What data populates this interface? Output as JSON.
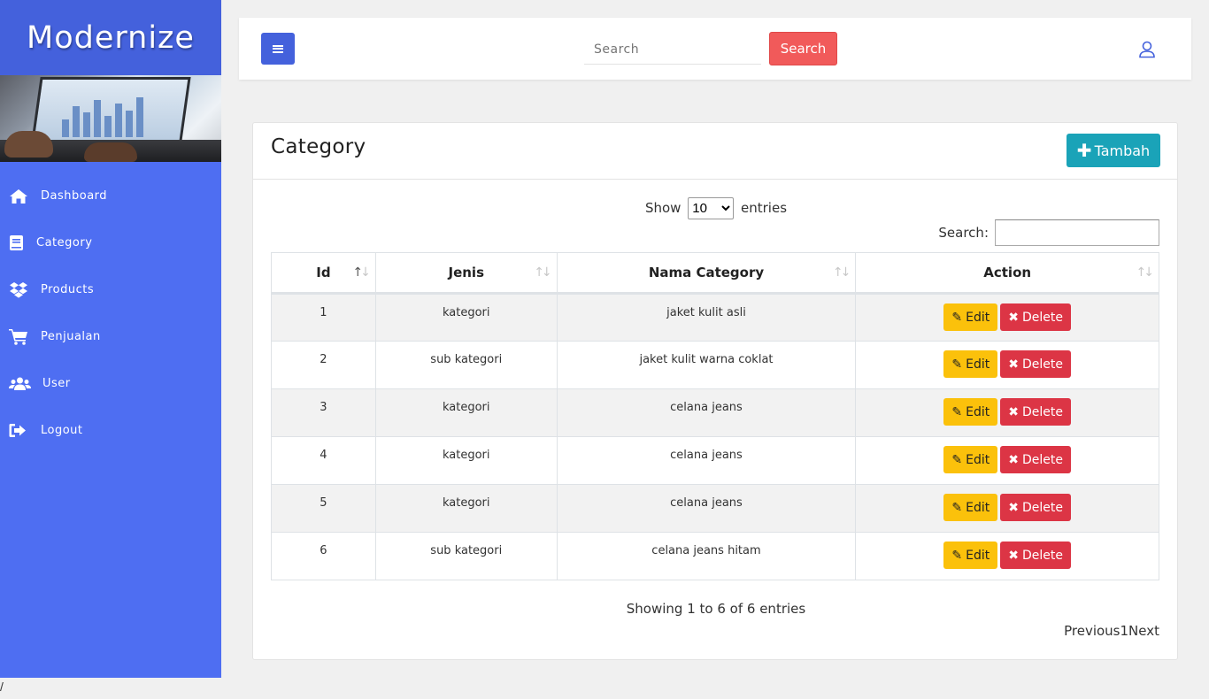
{
  "app": {
    "brand": "Modernize"
  },
  "sidebar": {
    "items": [
      {
        "label": "Dashboard",
        "icon": "home-icon"
      },
      {
        "label": "Category",
        "icon": "book-icon"
      },
      {
        "label": "Products",
        "icon": "dropbox-icon"
      },
      {
        "label": "Penjualan",
        "icon": "cart-icon"
      },
      {
        "label": "User",
        "icon": "users-icon"
      },
      {
        "label": "Logout",
        "icon": "sign-out-icon"
      }
    ]
  },
  "topbar": {
    "search_placeholder": "Search",
    "search_button": "Search"
  },
  "card": {
    "title": "Category",
    "add_button": "Tambah"
  },
  "datatable": {
    "show_label": "Show",
    "page_length": "10",
    "entries_label": "entries",
    "search_label": "Search:",
    "columns": [
      "Id",
      "Jenis",
      "Nama Category",
      "Action"
    ],
    "rows": [
      {
        "id": "1",
        "jenis": "kategori",
        "nama": "jaket kulit asli"
      },
      {
        "id": "2",
        "jenis": "sub kategori",
        "nama": "jaket kulit warna coklat"
      },
      {
        "id": "3",
        "jenis": "kategori",
        "nama": "celana jeans"
      },
      {
        "id": "4",
        "jenis": "kategori",
        "nama": "celana jeans"
      },
      {
        "id": "5",
        "jenis": "kategori",
        "nama": "celana jeans"
      },
      {
        "id": "6",
        "jenis": "sub kategori",
        "nama": "celana jeans hitam"
      }
    ],
    "edit_label": "Edit",
    "delete_label": "Delete",
    "info": "Showing 1 to 6 of 6 entries",
    "previous": "Previous",
    "page": "1",
    "next": "Next"
  },
  "footer": {
    "path": "/"
  },
  "colors": {
    "sidebar": "#4e6ef2",
    "brand_bg": "#4461dc",
    "search_button": "#f15a5a",
    "add_button": "#1aa3b8",
    "edit_button": "#fbc10b",
    "delete_button": "#dc3545"
  }
}
